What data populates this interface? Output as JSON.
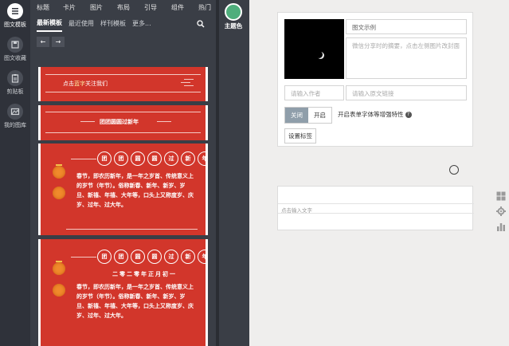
{
  "rail": {
    "items": [
      {
        "label": "图文模板",
        "icon": "list-icon"
      },
      {
        "label": "图文收藏",
        "icon": "save-icon"
      },
      {
        "label": "剪贴板",
        "icon": "clipboard-icon"
      },
      {
        "label": "我的图库",
        "icon": "gallery-icon"
      }
    ]
  },
  "panel": {
    "top_tabs": [
      "标题",
      "卡片",
      "图片",
      "布局",
      "引导",
      "组件",
      "热门"
    ],
    "sub_tabs": [
      "最新模板",
      "最近使用",
      "样刊模板",
      "更多..."
    ],
    "theme_label": "主题色",
    "theme_color": "#4fae7c",
    "prev_arrow": "←",
    "next_arrow": "→",
    "search_icon": "🔍",
    "templates": {
      "t1": {
        "text_pre": "点击",
        "text_em": "蓝字",
        "text_post": "关注我们"
      },
      "t2": {
        "text": "团团圆圆过新年"
      },
      "t3": {
        "chars": [
          "团",
          "团",
          "圆",
          "圆",
          "过",
          "新",
          "年"
        ],
        "body": "春节，即农历新年，是一年之岁首、传统意义上的岁节（年节）。俗称新春、新年、新岁、岁旦、新禧、年禧、大年等，口头上又称度岁、庆岁、过年、过大年。"
      },
      "t4": {
        "chars": [
          "团",
          "团",
          "圆",
          "圆",
          "过",
          "新",
          "年"
        ],
        "date": "二零二零年正月初一",
        "body": "春节，即农历新年，是一年之岁首、传统意义上的岁节（年节）。俗称新春、新年、新岁、岁旦、新禧、年禧、大年等，口头上又称度岁、庆岁、过年、过大年。"
      }
    },
    "accent": "#d2362b"
  },
  "article": {
    "title_value": "图文示例",
    "digest_placeholder": "微信分享时的摘要，点击左侧图片改封面",
    "author_placeholder": "请输入作者",
    "link_placeholder": "请输入原文链接",
    "toggle_off": "关闭",
    "toggle_on": "开启",
    "toggle_desc": "开启表单字体等增强特性",
    "help_icon": "?",
    "tag_button": "设置标签"
  },
  "editor": {
    "placeholder": "点击输入文字"
  },
  "side_tools": [
    "grid-icon",
    "gear-icon",
    "chart-icon"
  ]
}
